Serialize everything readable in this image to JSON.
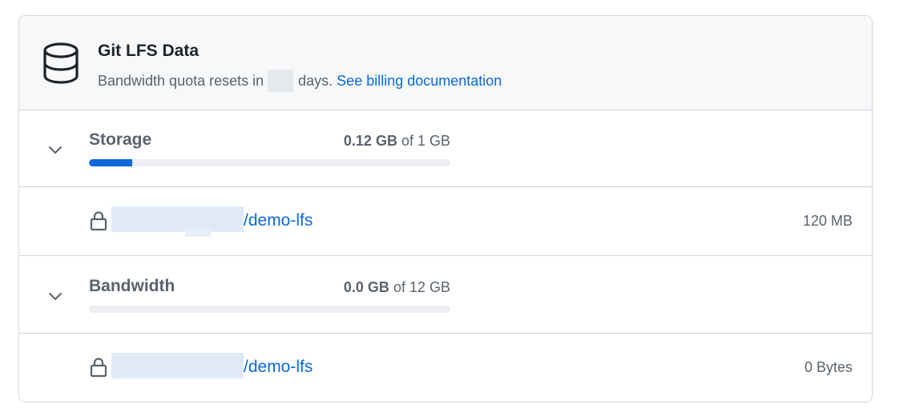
{
  "header": {
    "title": "Git LFS Data",
    "subtitle_before": "Bandwidth quota resets in",
    "subtitle_after": "days.",
    "billing_link": "See billing documentation",
    "icon": "database-icon"
  },
  "storage": {
    "label": "Storage",
    "used": "0.12 GB",
    "of_text": "of 1 GB",
    "used_fraction": 0.12,
    "bar_color": "#0969da",
    "repo": {
      "name": "/demo-lfs",
      "size": "120 MB",
      "icon": "lock-icon"
    }
  },
  "bandwidth": {
    "label": "Bandwidth",
    "used": "0.0 GB",
    "of_text": "of 12 GB",
    "used_fraction": 0.0,
    "bar_color": "#0969da",
    "repo": {
      "name": "/demo-lfs",
      "size": "0 Bytes",
      "icon": "lock-icon"
    }
  }
}
